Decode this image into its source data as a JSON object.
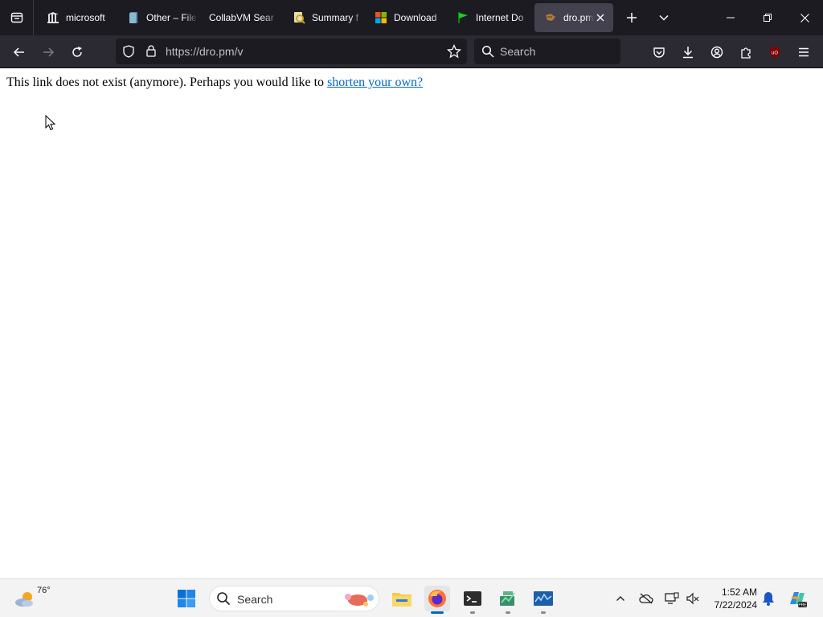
{
  "browser": {
    "tabs": [
      {
        "title": "microsoft",
        "icon": "library-icon"
      },
      {
        "title": "Other – File",
        "icon": "document-icon"
      },
      {
        "title": "CollabVM Sear",
        "icon": "blank-icon"
      },
      {
        "title": "Summary f",
        "icon": "lens-icon"
      },
      {
        "title": "Download",
        "icon": "windows-logo-icon"
      },
      {
        "title": "Internet Do",
        "icon": "flag-icon"
      },
      {
        "title": "dro.pm/",
        "icon": "fox-icon"
      }
    ],
    "url": "https://dro.pm/v",
    "search_placeholder": "Search"
  },
  "page": {
    "message": "This link does not exist (anymore). Perhaps you would like to",
    "link_text": "shorten your own?"
  },
  "taskbar": {
    "temperature": "76°",
    "search_placeholder": "Search",
    "time": "1:52 AM",
    "date": "7/22/2024"
  },
  "colors": {
    "tab_strip": "#1c1b22",
    "toolbar": "#2b2a33",
    "link": "#0066cc",
    "taskbar": "#f3f3f3",
    "accent": "#0067c0"
  }
}
